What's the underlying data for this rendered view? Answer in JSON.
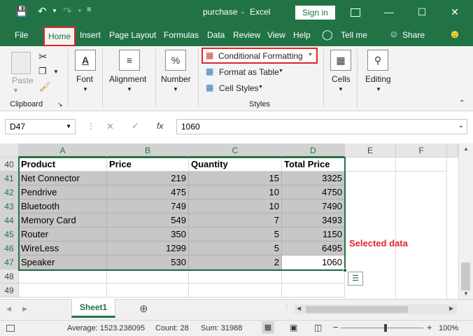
{
  "titlebar": {
    "doc_title": "purchase",
    "separator": "-",
    "app_name": "Excel",
    "signin_label": "Sign in"
  },
  "menu": {
    "file": "File",
    "home": "Home",
    "insert": "Insert",
    "page_layout": "Page Layout",
    "formulas": "Formulas",
    "data": "Data",
    "review": "Review",
    "view": "View",
    "help": "Help",
    "tell_me": "Tell me",
    "share": "Share"
  },
  "ribbon": {
    "paste": "Paste",
    "clipboard": "Clipboard",
    "font": "Font",
    "alignment": "Alignment",
    "number": "Number",
    "number_icon": "%",
    "conditional_formatting": "Conditional Formatting",
    "format_as_table": "Format as Table",
    "cell_styles": "Cell Styles",
    "styles": "Styles",
    "cells": "Cells",
    "editing": "Editing"
  },
  "formula_bar": {
    "name_box": "D47",
    "fx": "fx",
    "value": "1060"
  },
  "columns": [
    "A",
    "B",
    "C",
    "D",
    "E",
    "F"
  ],
  "rows": [
    "40",
    "41",
    "42",
    "43",
    "44",
    "45",
    "46",
    "47",
    "48",
    "49"
  ],
  "table": {
    "headers": [
      "Product",
      "Price",
      "Quantity",
      "Total Price"
    ],
    "rows": [
      [
        "Net Connector",
        "219",
        "15",
        "3325"
      ],
      [
        "Pendrive",
        "475",
        "10",
        "4750"
      ],
      [
        "Bluetooth",
        "749",
        "10",
        "7490"
      ],
      [
        "Memory Card",
        "549",
        "7",
        "3493"
      ],
      [
        "Router",
        "350",
        "5",
        "1150"
      ],
      [
        "WireLess",
        "1299",
        "5",
        "6495"
      ],
      [
        "Speaker",
        "530",
        "2",
        "1060"
      ]
    ]
  },
  "annotation": "Selected data",
  "sheet_tab": "Sheet1",
  "status": {
    "average": "Average: 1523.238095",
    "count": "Count: 28",
    "sum": "Sum: 31988",
    "zoom": "100%"
  },
  "colors": {
    "excel_green": "#217346",
    "highlight_red": "#e0252b",
    "selection_gray": "#c7c7c7"
  }
}
